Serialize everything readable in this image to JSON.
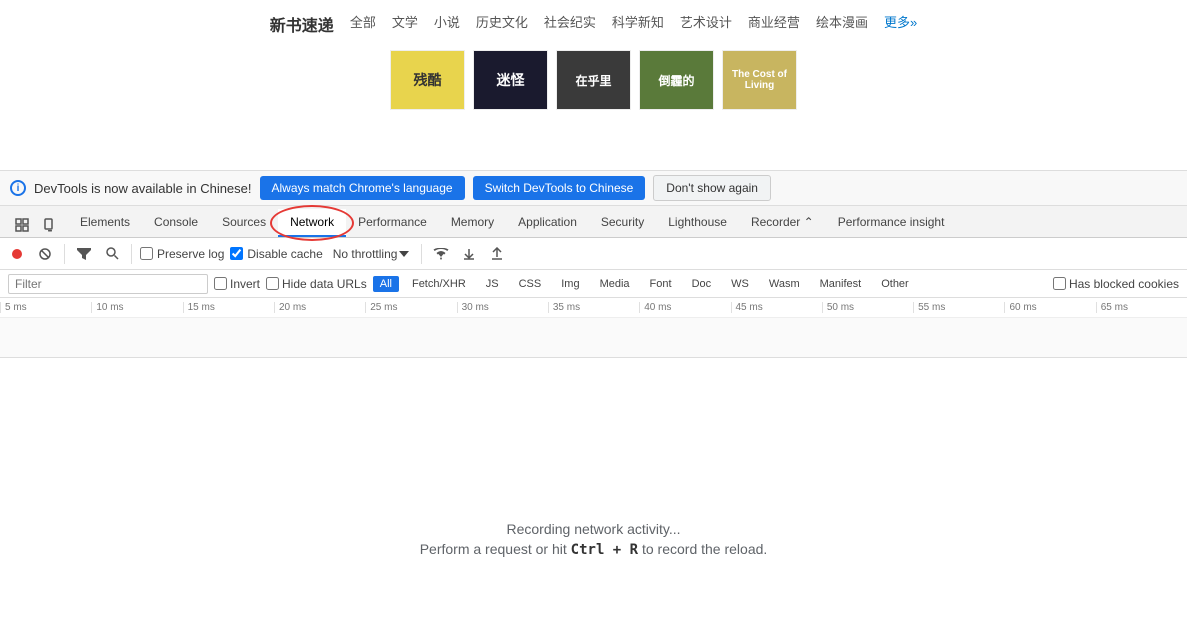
{
  "website": {
    "title": "新书速递",
    "nav_items": [
      "全部",
      "文学",
      "小说",
      "历史文化",
      "社会纪实",
      "科学新知",
      "艺术设计",
      "商业经营",
      "绘本漫画"
    ],
    "more_label": "更多»",
    "books": [
      {
        "color": "#e8d44d",
        "text": "残酷",
        "bg": "#e8d44d"
      },
      {
        "color": "#1a1a2e",
        "text": "迷怪",
        "bg": "#2c2c54"
      },
      {
        "color": "#3d3d3d",
        "text": "在乎里",
        "bg": "#4a4a4a"
      },
      {
        "color": "#5a7a3a",
        "text": "倒霾的",
        "bg": "#6b8f4a"
      },
      {
        "color": "#c8b560",
        "text": "The Cost of Living",
        "bg": "#c8b560"
      }
    ]
  },
  "notification": {
    "info_text": "DevTools is now available in Chinese!",
    "btn_match": "Always match Chrome's language",
    "btn_switch": "Switch DevTools to Chinese",
    "btn_dismiss": "Don't show again"
  },
  "devtools": {
    "tabs": [
      {
        "label": "Elements",
        "id": "elements"
      },
      {
        "label": "Console",
        "id": "console"
      },
      {
        "label": "Sources",
        "id": "sources"
      },
      {
        "label": "Network",
        "id": "network",
        "active": true
      },
      {
        "label": "Performance",
        "id": "performance"
      },
      {
        "label": "Memory",
        "id": "memory"
      },
      {
        "label": "Application",
        "id": "application"
      },
      {
        "label": "Security",
        "id": "security"
      },
      {
        "label": "Lighthouse",
        "id": "lighthouse"
      },
      {
        "label": "Recorder ⌃",
        "id": "recorder"
      },
      {
        "label": "Performance insight",
        "id": "performance-insight"
      }
    ],
    "toolbar": {
      "preserve_log_label": "Preserve log",
      "disable_cache_label": "Disable cache",
      "throttle_label": "No throttling"
    },
    "filter": {
      "placeholder": "Filter",
      "invert_label": "Invert",
      "hide_data_urls_label": "Hide data URLs",
      "type_buttons": [
        "All",
        "Fetch/XHR",
        "JS",
        "CSS",
        "Img",
        "Media",
        "Font",
        "Doc",
        "WS",
        "Wasm",
        "Manifest",
        "Other"
      ],
      "has_blocked_label": "Has blocked cookies"
    },
    "timeline": {
      "ticks": [
        "5 ms",
        "10 ms",
        "15 ms",
        "20 ms",
        "25 ms",
        "30 ms",
        "35 ms",
        "40 ms",
        "45 ms",
        "50 ms",
        "55 ms",
        "60 ms",
        "65 ms"
      ]
    },
    "empty_state": {
      "recording_text": "Recording network activity...",
      "hint_text": "Perform a request or hit",
      "shortcut": "Ctrl + R",
      "hint_text2": "to record the reload."
    }
  }
}
